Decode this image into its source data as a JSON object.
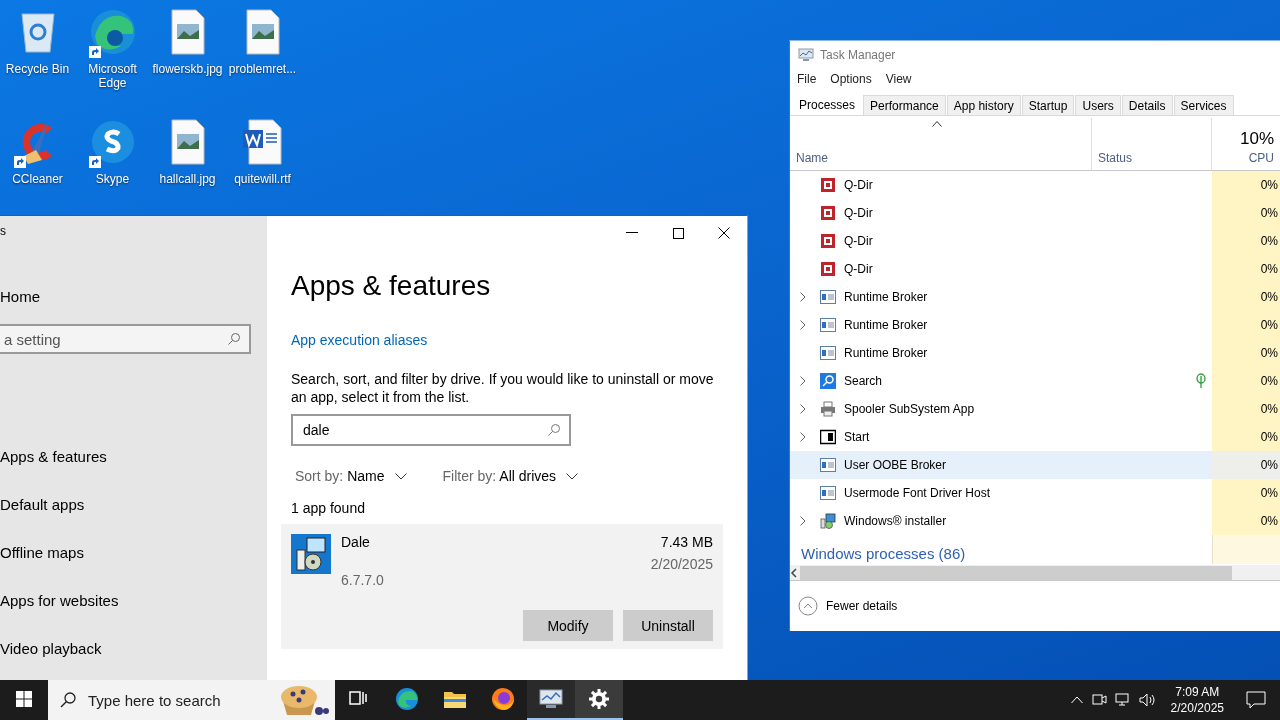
{
  "desktop_icons": [
    {
      "label": "Recycle Bin",
      "kind": "recycle",
      "shortcut": false
    },
    {
      "label": "Microsoft Edge",
      "kind": "edge",
      "shortcut": true
    },
    {
      "label": "flowerskb.jpg",
      "kind": "image",
      "shortcut": false
    },
    {
      "label": "problemret...",
      "kind": "image",
      "shortcut": false
    },
    {
      "label": "CCleaner",
      "kind": "ccleaner",
      "shortcut": true
    },
    {
      "label": "Skype",
      "kind": "skype",
      "shortcut": true
    },
    {
      "label": "hallcall.jpg",
      "kind": "image",
      "shortcut": false
    },
    {
      "label": "quitewill.rtf",
      "kind": "word",
      "shortcut": false
    }
  ],
  "settings": {
    "title": "s",
    "home": "Home",
    "search": {
      "placeholder": "a setting"
    },
    "nav": [
      {
        "label": "Apps & features"
      },
      {
        "label": "Default apps"
      },
      {
        "label": "Offline maps"
      },
      {
        "label": "Apps for websites"
      },
      {
        "label": "Video playback"
      }
    ],
    "heading": "Apps & features",
    "link": "App execution aliases",
    "description": "Search, sort, and filter by drive. If you would like to uninstall or move an app, select it from the list.",
    "app_search": {
      "value": "dale"
    },
    "sort": {
      "label": "Sort by:",
      "value": "Name"
    },
    "filter": {
      "label": "Filter by:",
      "value": "All drives"
    },
    "count": "1 app found",
    "apps": [
      {
        "name": "Dale",
        "version": "6.7.7.0",
        "size": "7.43 MB",
        "date": "2/20/2025",
        "selected": true,
        "buttons": [
          "Modify",
          "Uninstall"
        ]
      }
    ]
  },
  "task_manager": {
    "title": "Task Manager",
    "menu": [
      "File",
      "Options",
      "View"
    ],
    "tabs": [
      {
        "label": "Processes",
        "selected": true
      },
      {
        "label": "Performance",
        "selected": false
      },
      {
        "label": "App history",
        "selected": false
      },
      {
        "label": "Startup",
        "selected": false
      },
      {
        "label": "Users",
        "selected": false
      },
      {
        "label": "Details",
        "selected": false
      },
      {
        "label": "Services",
        "selected": false
      }
    ],
    "columns": {
      "name": "Name",
      "status": "Status",
      "cpu_total": "10%",
      "cpu": "CPU"
    },
    "processes": [
      {
        "name": "Q-Dir",
        "kind": "qdir",
        "expandable": false,
        "selected": false,
        "eco": false,
        "cpu": "0%"
      },
      {
        "name": "Q-Dir",
        "kind": "qdir",
        "expandable": false,
        "selected": false,
        "eco": false,
        "cpu": "0%"
      },
      {
        "name": "Q-Dir",
        "kind": "qdir",
        "expandable": false,
        "selected": false,
        "eco": false,
        "cpu": "0%"
      },
      {
        "name": "Q-Dir",
        "kind": "qdir",
        "expandable": false,
        "selected": false,
        "eco": false,
        "cpu": "0%"
      },
      {
        "name": "Runtime Broker",
        "kind": "window",
        "expandable": true,
        "selected": false,
        "eco": false,
        "cpu": "0%"
      },
      {
        "name": "Runtime Broker",
        "kind": "window",
        "expandable": true,
        "selected": false,
        "eco": false,
        "cpu": "0%"
      },
      {
        "name": "Runtime Broker",
        "kind": "window",
        "expandable": false,
        "selected": false,
        "eco": false,
        "cpu": "0%"
      },
      {
        "name": "Search",
        "kind": "search",
        "expandable": true,
        "selected": false,
        "eco": true,
        "cpu": "0%"
      },
      {
        "name": "Spooler SubSystem App",
        "kind": "printer",
        "expandable": true,
        "selected": false,
        "eco": false,
        "cpu": "0%"
      },
      {
        "name": "Start",
        "kind": "start",
        "expandable": true,
        "selected": false,
        "eco": false,
        "cpu": "0%"
      },
      {
        "name": "User OOBE Broker",
        "kind": "window",
        "expandable": false,
        "selected": true,
        "eco": false,
        "cpu": "0%"
      },
      {
        "name": "Usermode Font Driver Host",
        "kind": "window",
        "expandable": false,
        "selected": false,
        "eco": false,
        "cpu": "0%"
      },
      {
        "name": "Windows® installer",
        "kind": "installer",
        "expandable": true,
        "selected": false,
        "eco": false,
        "cpu": "0%"
      }
    ],
    "group": "Windows processes (86)",
    "footer": "Fewer details"
  },
  "taskbar": {
    "search": {
      "placeholder": "Type here to search"
    },
    "apps": [
      {
        "kind": "taskview",
        "running": false,
        "selected": false
      },
      {
        "kind": "edge",
        "running": false,
        "selected": false
      },
      {
        "kind": "explorer",
        "running": false,
        "selected": false
      },
      {
        "kind": "firefox",
        "running": false,
        "selected": false
      },
      {
        "kind": "taskmanager",
        "running": true,
        "selected": false
      },
      {
        "kind": "settings",
        "running": true,
        "selected": true
      }
    ],
    "clock": {
      "time": "7:09 AM",
      "date": "2/20/2025"
    }
  }
}
